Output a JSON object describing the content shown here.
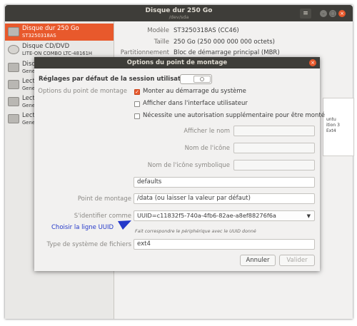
{
  "window": {
    "title": "Disque dur 250 Go",
    "subtitle": "/dev/sda",
    "menu_glyph": "≡",
    "minimize_glyph": "–",
    "maximize_glyph": "□",
    "close_glyph": "×"
  },
  "sidebar": {
    "items": [
      {
        "name": "Disque dur 250 Go",
        "sub": "ST3250318AS",
        "selected": true
      },
      {
        "name": "Disque CD/DVD",
        "sub": "LITE-ON COMBO LTC-48161H"
      },
      {
        "name": "Disqu",
        "sub": "Gene"
      },
      {
        "name": "Lecte",
        "sub": "Gene"
      },
      {
        "name": "Lecte",
        "sub": "Gene"
      },
      {
        "name": "Lecte",
        "sub": "Gene"
      }
    ]
  },
  "info": {
    "rows": [
      {
        "label": "Modèle",
        "value": "ST3250318AS (CC46)"
      },
      {
        "label": "Taille",
        "value": "250 Go (250 000 000 000 octets)"
      },
      {
        "label": "Partitionnement",
        "value": "Bloc de démarrage principal (MBR)"
      }
    ],
    "side_lines": [
      "untu",
      "ition 3",
      "Ext4"
    ]
  },
  "dialog": {
    "title": "Options du point de montage",
    "close_glyph": "×",
    "defaults_label": "Réglages par défaut de la session utilisateur",
    "mount_options_label": "Options du point de montage",
    "checkboxes": [
      {
        "label": "Monter au démarrage du système",
        "checked": true,
        "check_glyph": "✓"
      },
      {
        "label": "Afficher dans l'interface utilisateur",
        "checked": false
      },
      {
        "label": "Nécessite une autorisation supplémentaire pour être monté",
        "checked": false
      }
    ],
    "display_name_label": "Afficher le nom",
    "display_name_value": "",
    "icon_name_label": "Nom de l'icône",
    "icon_name_value": "",
    "symbolic_icon_label": "Nom de l'icône symbolique",
    "symbolic_icon_value": "",
    "options_value": "defaults",
    "mount_point_label": "Point de montage",
    "mount_point_value": "/data  (ou laisser la valeur par défaut)",
    "identify_label": "S'identifier comme",
    "identify_value": "UUID=c11832f5-740a-4fb6-82ae-a8ef88276f6a",
    "identify_hint": "Fait correspondre le périphérique avec le UUID donné",
    "annotation": "Choisir la ligne UUID",
    "fs_type_label": "Type de système de fichiers",
    "fs_type_value": "ext4",
    "cancel_label": "Annuler",
    "ok_label": "Valider",
    "combo_arrow": "▼"
  },
  "colors": {
    "accent": "#e8592c",
    "titlebar": "#3e3d39",
    "annotation": "#2438c9"
  }
}
